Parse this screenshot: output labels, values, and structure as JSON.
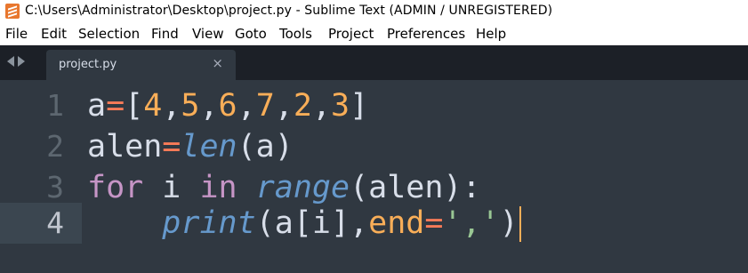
{
  "window": {
    "title": "C:\\Users\\Administrator\\Desktop\\project.py - Sublime Text (ADMIN / UNREGISTERED)"
  },
  "menu": [
    {
      "label": "File"
    },
    {
      "label": "Edit"
    },
    {
      "label": "Selection"
    },
    {
      "label": "Find"
    },
    {
      "label": "View"
    },
    {
      "label": "Goto"
    },
    {
      "label": "Tools"
    },
    {
      "label": "Project"
    },
    {
      "label": "Preferences"
    },
    {
      "label": "Help"
    }
  ],
  "tabs": [
    {
      "label": "project.py",
      "close": "×",
      "active": true
    }
  ],
  "editor": {
    "current_line": 4,
    "lines": [
      {
        "number": "1",
        "text": "a=[4,5,6,7,2,3]"
      },
      {
        "number": "2",
        "text": "alen=len(a)"
      },
      {
        "number": "3",
        "text": "for i in range(alen):"
      },
      {
        "number": "4",
        "text": "    print(a[i],end=',')"
      }
    ]
  },
  "colors": {
    "editor_bg": "#303841",
    "tabbar_bg": "#1c2027",
    "accent_orange": "#f9ae58",
    "operator": "#f97b58",
    "keyword": "#c695c6",
    "builtin": "#6699cc",
    "string": "#99c794"
  },
  "icons": [
    "sublime-text-logo-icon",
    "tab-scroll-left-icon",
    "tab-scroll-right-icon",
    "close-icon"
  ]
}
